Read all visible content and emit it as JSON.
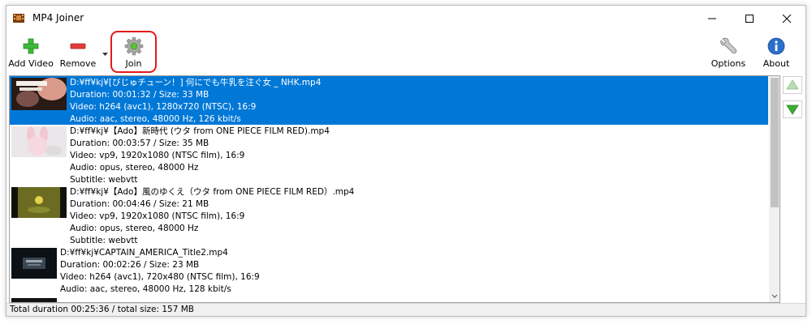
{
  "window": {
    "title": "MP4 Joiner"
  },
  "toolbar": {
    "add_video": "Add Video",
    "remove": "Remove",
    "join": "Join",
    "options": "Options",
    "about": "About"
  },
  "files": [
    {
      "path": "D:¥ff¥kj¥[びじゅチューン！] 何にでも牛乳を注ぐ女 _ NHK.mp4",
      "duration": "Duration: 00:01:32 / Size: 33 MB",
      "video": "Video: h264 (avc1), 1280x720 (NTSC), 16:9",
      "audio": "Audio: aac, stereo, 48000 Hz, 126 kbit/s",
      "subtitle": "",
      "selected": true
    },
    {
      "path": "D:¥ff¥kj¥【Ado】新時代 (ウタ from ONE PIECE FILM RED).mp4",
      "duration": "Duration: 00:03:57 / Size: 35 MB",
      "video": "Video: vp9, 1920x1080 (NTSC film), 16:9",
      "audio": "Audio: opus, stereo, 48000 Hz",
      "subtitle": "Subtitle: webvtt",
      "selected": false
    },
    {
      "path": "D:¥ff¥kj¥【Ado】風のゆくえ（ウタ from ONE PIECE FILM RED）.mp4",
      "duration": "Duration: 00:04:46 / Size: 21 MB",
      "video": "Video: vp9, 1920x1080 (NTSC film), 16:9",
      "audio": "Audio: opus, stereo, 48000 Hz",
      "subtitle": "Subtitle: webvtt",
      "selected": false
    },
    {
      "path": "D:¥ff¥kj¥CAPTAIN_AMERICA_Title2.mp4",
      "duration": "Duration: 00:02:26 / Size: 23 MB",
      "video": "Video: h264 (avc1), 720x480 (NTSC film), 16:9",
      "audio": "Audio: aac, stereo, 48000 Hz, 128 kbit/s",
      "subtitle": "",
      "selected": false
    }
  ],
  "status": {
    "text": "Total duration 00:25:36 / total size: 157 MB"
  },
  "colors": {
    "selection": "#0078d7",
    "highlight_border": "#e31b1b",
    "add_green": "#3fb83a",
    "remove_red": "#e23b3b"
  }
}
